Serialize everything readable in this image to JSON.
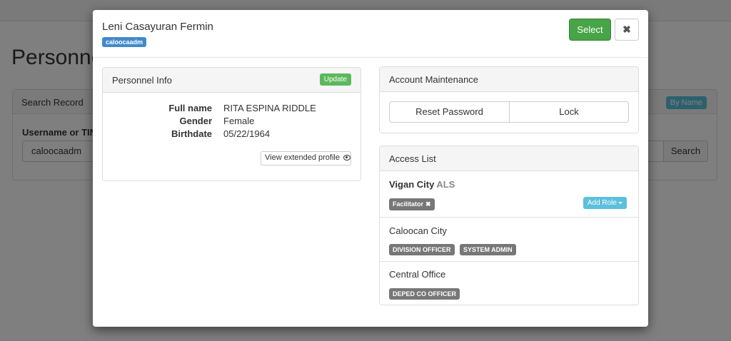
{
  "background": {
    "page_title": "Personnel",
    "search_panel": {
      "title": "Search Record",
      "by_name_label": "By Name",
      "field_label": "Username or TIN",
      "input_value": "caloocaadm",
      "search_button": "Search"
    }
  },
  "modal": {
    "title": "Leni Casayuran Fermin",
    "username_badge": "caloocaadm",
    "select_button": "Select",
    "close_icon": "✖",
    "personnel_info": {
      "heading": "Personnel Info",
      "update_button": "Update",
      "fields": [
        {
          "label": "Full name",
          "value": "RITA ESPINA RIDDLE"
        },
        {
          "label": "Gender",
          "value": "Female"
        },
        {
          "label": "Birthdate",
          "value": "05/22/1964"
        }
      ],
      "extended_profile_button": "View extended profile"
    },
    "account_maintenance": {
      "heading": "Account Maintenance",
      "reset_password_button": "Reset Password",
      "lock_button": "Lock"
    },
    "access_list": {
      "heading": "Access List",
      "items": [
        {
          "name": "Vigan City",
          "type": "ALS",
          "roles": [
            "Facilitator"
          ],
          "add_role_button": "Add Role"
        },
        {
          "name": "Caloocan City",
          "roles": [
            "DIVISION OFFICER",
            "SYSTEM ADMIN"
          ]
        },
        {
          "name": "Central Office",
          "roles": [
            "DEPED CO OFFICER"
          ]
        }
      ],
      "remove_icon": "✖"
    }
  },
  "colors": {
    "primary": "#428bca",
    "success": "#47a447",
    "info": "#5bc0de",
    "default_tag": "#777777",
    "overlay": "rgba(0,0,0,0.5)"
  }
}
